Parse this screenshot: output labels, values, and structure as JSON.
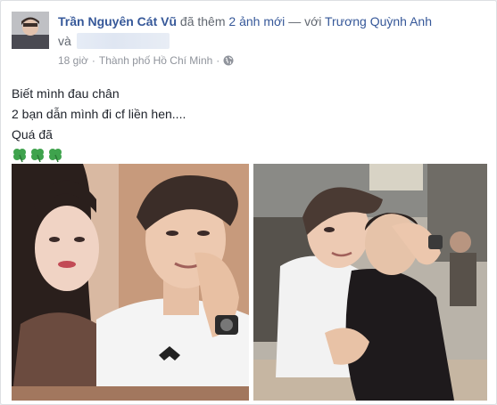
{
  "post": {
    "author": "Trần Nguyên Cát Vũ",
    "action": "đã thêm",
    "photo_count_link": "2 ảnh mới",
    "with_text": "— với",
    "tagged_user": "Trương Quỳnh Anh",
    "and_text": "và",
    "timestamp": "18 giờ",
    "separator": "·",
    "location": "Thành phố Hồ Chí Minh",
    "privacy_icon": "globe-icon",
    "lines": [
      "Biết mình đau chân",
      "2 bạn dẫn mình đi cf liền hen....",
      "Quá đã"
    ],
    "emojis": [
      "four-leaf-clover-icon",
      "four-leaf-clover-icon",
      "four-leaf-clover-icon"
    ]
  },
  "colors": {
    "link": "#365899",
    "text": "#1d2129",
    "meta": "#90949c",
    "clover": "#3fa34d"
  }
}
